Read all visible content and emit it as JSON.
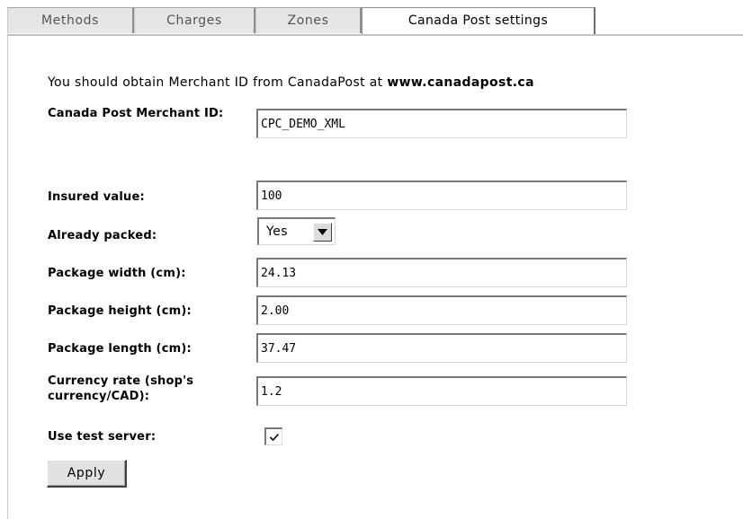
{
  "tabs": [
    {
      "label": "Methods"
    },
    {
      "label": "Charges"
    },
    {
      "label": "Zones"
    },
    {
      "label": "Canada Post settings",
      "active": true
    }
  ],
  "intro": {
    "text": "You should obtain Merchant ID from CanadaPost at ",
    "link": "www.canadapost.ca"
  },
  "form": {
    "merchant_id": {
      "label": "Canada Post Merchant ID:",
      "value": "CPC_DEMO_XML"
    },
    "insured_value": {
      "label": "Insured value:",
      "value": "100"
    },
    "already_packed": {
      "label": "Already packed:",
      "value": "Yes"
    },
    "package_width": {
      "label": "Package width (cm):",
      "value": "24.13"
    },
    "package_height": {
      "label": "Package height (cm):",
      "value": "2.00"
    },
    "package_length": {
      "label": "Package length (cm):",
      "value": "37.47"
    },
    "currency_rate": {
      "label": "Currency rate (shop's currency/CAD):",
      "value": "1.2"
    },
    "use_test_server": {
      "label": "Use test server:",
      "checked": true
    }
  },
  "apply_label": "Apply"
}
